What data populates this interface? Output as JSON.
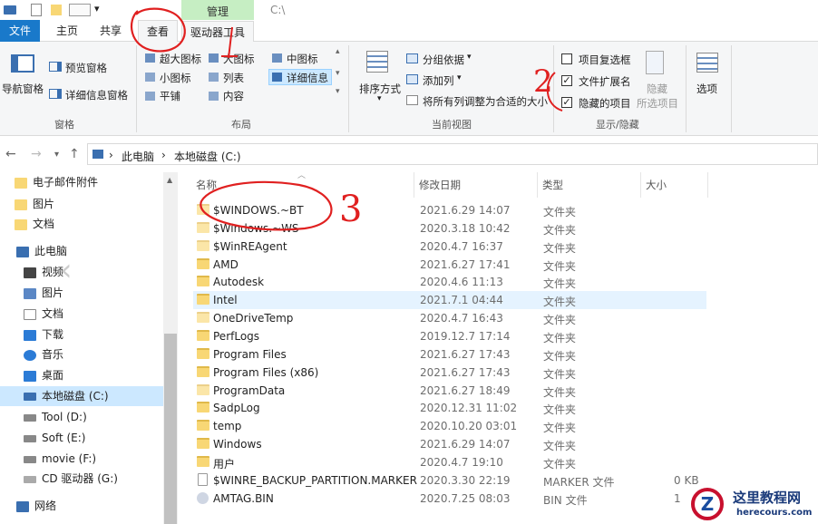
{
  "window": {
    "manage_tab": "管理",
    "path_title": "C:\\"
  },
  "tabs": {
    "file": "文件",
    "home": "主页",
    "share": "共享",
    "view": "查看",
    "drive_tools": "驱动器工具"
  },
  "ribbon": {
    "panes": {
      "nav_pane": "导航窗格",
      "preview_pane": "预览窗格",
      "details_pane": "详细信息窗格",
      "label": "窗格"
    },
    "layout": {
      "xl_icons": "超大图标",
      "large_icons": "大图标",
      "medium_icons": "中图标",
      "small_icons": "小图标",
      "list": "列表",
      "details": "详细信息",
      "tiles": "平铺",
      "content": "内容",
      "label": "布局"
    },
    "current_view": {
      "sort_by": "排序方式",
      "group_by": "分组依据",
      "add_columns": "添加列",
      "fit_columns": "将所有列调整为合适的大小",
      "label": "当前视图"
    },
    "show_hide": {
      "item_checkboxes": "项目复选框",
      "file_extensions": "文件扩展名",
      "hidden_items": "隐藏的项目",
      "hide_selected": "隐藏",
      "selected_items": "所选项目",
      "label": "显示/隐藏"
    },
    "options": "选项"
  },
  "address": {
    "this_pc": "此电脑",
    "drive": "本地磁盘 (C:)",
    "sep": "›"
  },
  "nav": [
    {
      "label": "电子邮件附件"
    },
    {
      "label": "图片"
    },
    {
      "label": "文档"
    },
    {
      "label": "此电脑"
    },
    {
      "label": "视频"
    },
    {
      "label": "图片"
    },
    {
      "label": "文档"
    },
    {
      "label": "下载"
    },
    {
      "label": "音乐"
    },
    {
      "label": "桌面"
    },
    {
      "label": "本地磁盘 (C:)"
    },
    {
      "label": "Tool (D:)"
    },
    {
      "label": "Soft (E:)"
    },
    {
      "label": "movie (F:)"
    },
    {
      "label": "CD 驱动器 (G:)"
    },
    {
      "label": "网络"
    }
  ],
  "columns": {
    "name": "名称",
    "date": "修改日期",
    "type": "类型",
    "size": "大小"
  },
  "files": [
    {
      "name": "$WINDOWS.~BT",
      "date": "2021.6.29 14:07",
      "type": "文件夹",
      "size": ""
    },
    {
      "name": "$Windows.~WS",
      "date": "2020.3.18 10:42",
      "type": "文件夹",
      "size": ""
    },
    {
      "name": "$WinREAgent",
      "date": "2020.4.7 16:37",
      "type": "文件夹",
      "size": ""
    },
    {
      "name": "AMD",
      "date": "2021.6.27 17:41",
      "type": "文件夹",
      "size": ""
    },
    {
      "name": "Autodesk",
      "date": "2020.4.6 11:13",
      "type": "文件夹",
      "size": ""
    },
    {
      "name": "Intel",
      "date": "2021.7.1 04:44",
      "type": "文件夹",
      "size": ""
    },
    {
      "name": "OneDriveTemp",
      "date": "2020.4.7 16:43",
      "type": "文件夹",
      "size": ""
    },
    {
      "name": "PerfLogs",
      "date": "2019.12.7 17:14",
      "type": "文件夹",
      "size": ""
    },
    {
      "name": "Program Files",
      "date": "2021.6.27 17:43",
      "type": "文件夹",
      "size": ""
    },
    {
      "name": "Program Files (x86)",
      "date": "2021.6.27 17:43",
      "type": "文件夹",
      "size": ""
    },
    {
      "name": "ProgramData",
      "date": "2021.6.27 18:49",
      "type": "文件夹",
      "size": ""
    },
    {
      "name": "SadpLog",
      "date": "2020.12.31 11:02",
      "type": "文件夹",
      "size": ""
    },
    {
      "name": "temp",
      "date": "2020.10.20 03:01",
      "type": "文件夹",
      "size": ""
    },
    {
      "name": "Windows",
      "date": "2021.6.29 14:07",
      "type": "文件夹",
      "size": ""
    },
    {
      "name": "用户",
      "date": "2020.4.7 19:10",
      "type": "文件夹",
      "size": ""
    },
    {
      "name": "$WINRE_BACKUP_PARTITION.MARKER",
      "date": "2020.3.30 22:19",
      "type": "MARKER 文件",
      "size": "0 KB"
    },
    {
      "name": "AMTAG.BIN",
      "date": "2020.7.25 08:03",
      "type": "BIN 文件",
      "size": "1"
    }
  ],
  "watermark": {
    "title": "这里教程网",
    "url": "herecours.com"
  },
  "annotations": {
    "two": "2",
    "three": "3"
  },
  "colors": {
    "accent": "#1979ca",
    "manage": "#c6eec3",
    "selection": "#cce8ff",
    "annotation": "#e02020"
  }
}
